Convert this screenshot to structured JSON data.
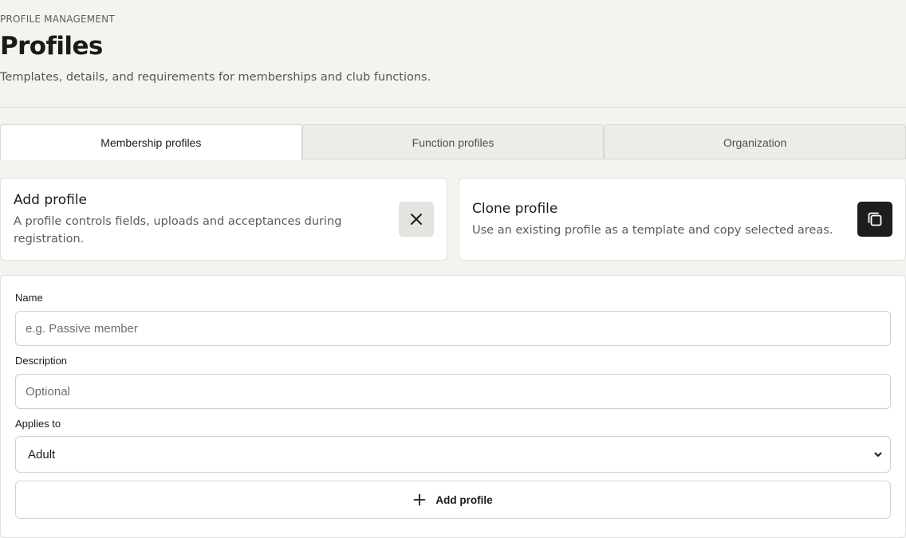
{
  "header": {
    "eyebrow": "PROFILE MANAGEMENT",
    "title": "Profiles",
    "subtitle": "Templates, details, and requirements for memberships and club functions."
  },
  "tabs": [
    {
      "label": "Membership profiles",
      "active": true
    },
    {
      "label": "Function profiles",
      "active": false
    },
    {
      "label": "Organization",
      "active": false
    }
  ],
  "cards": {
    "add": {
      "title": "Add profile",
      "description": "A profile controls fields, uploads and acceptances during registration.",
      "icon": "close-icon"
    },
    "clone": {
      "title": "Clone profile",
      "description": "Use an existing profile as a template and copy selected areas.",
      "icon": "copy-icon"
    }
  },
  "form": {
    "name": {
      "label": "Name",
      "value": "",
      "placeholder": "e.g. Passive member"
    },
    "description": {
      "label": "Description",
      "value": "",
      "placeholder": "Optional"
    },
    "applies_to": {
      "label": "Applies to",
      "selected": "Adult"
    },
    "submit": {
      "label": "Add profile",
      "icon": "plus-icon"
    }
  },
  "colors": {
    "background": "#f3f4f0",
    "surface": "#ffffff",
    "dark_button": "#1d1d1b",
    "muted_button": "#e3e4df",
    "border": "#d6d8d0"
  }
}
